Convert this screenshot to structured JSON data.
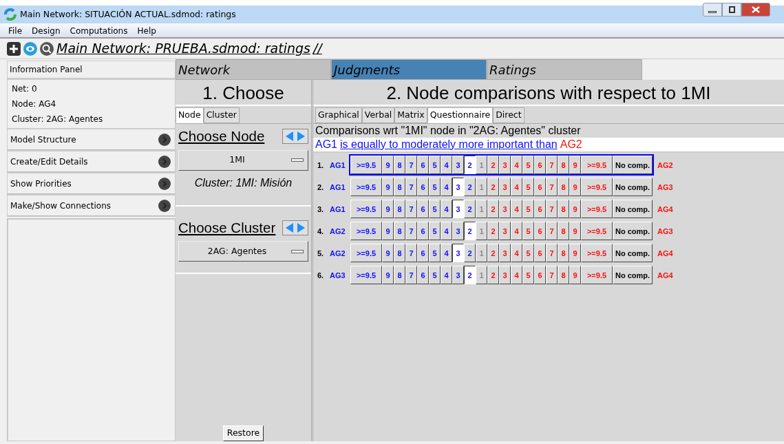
{
  "window": {
    "title": "Main Network: SITUACIÓN ACTUAL.sdmod: ratings"
  },
  "menu": [
    "File",
    "Design",
    "Computations",
    "Help"
  ],
  "toolbar": {
    "title": "Main Network: PRUEBA.sdmod: ratings",
    "suffix": "//"
  },
  "sidebar": {
    "info_title": "Information Panel",
    "info_lines": [
      "Net: 0",
      "Node: AG4",
      "Cluster: 2AG: Agentes"
    ],
    "items": [
      "Model Structure",
      "Create/Edit Details",
      "Show Priorities",
      "Make/Show Connections"
    ]
  },
  "main_tabs": [
    {
      "label": "Network",
      "selected": false
    },
    {
      "label": "Judgments",
      "selected": true
    },
    {
      "label": "Ratings",
      "selected": false
    }
  ],
  "choose": {
    "heading": "1. Choose",
    "tabs": [
      {
        "label": "Node",
        "selected": true
      },
      {
        "label": "Cluster",
        "selected": false
      }
    ],
    "node_label": "Choose Node",
    "node_value": "1MI",
    "node_cluster": "Cluster: 1MI: Misión",
    "cluster_label": "Choose Cluster",
    "cluster_value": "2AG: Agentes",
    "restore": "Restore"
  },
  "comparisons": {
    "heading": "2. Node comparisons with respect to 1MI",
    "tabs": [
      {
        "label": "Graphical",
        "selected": false
      },
      {
        "label": "Verbal",
        "selected": false
      },
      {
        "label": "Matrix",
        "selected": false
      },
      {
        "label": "Questionnaire",
        "selected": true
      },
      {
        "label": "Direct",
        "selected": false
      }
    ],
    "caption": "Comparisons wrt \"1MI\" node in \"2AG: Agentes\" cluster",
    "verdict": {
      "left": "AG1",
      "phrase": "is equally to moderately more important than",
      "right": "AG2"
    },
    "rows": [
      {
        "number": "1.",
        "left": "AG1",
        "right": "AG2",
        "focused": true,
        "cells": [
          {
            "label": ">=9.5",
            "kind": "left",
            "selected": false
          },
          {
            "label": "9",
            "kind": "left",
            "selected": false
          },
          {
            "label": "8",
            "kind": "left",
            "selected": false
          },
          {
            "label": "7",
            "kind": "left",
            "selected": false
          },
          {
            "label": "6",
            "kind": "left",
            "selected": false
          },
          {
            "label": "5",
            "kind": "left",
            "selected": false
          },
          {
            "label": "4",
            "kind": "left",
            "selected": false
          },
          {
            "label": "3",
            "kind": "left",
            "selected": false
          },
          {
            "label": "2",
            "kind": "left",
            "selected": true
          },
          {
            "label": "1",
            "kind": "center",
            "selected": false
          },
          {
            "label": "2",
            "kind": "right",
            "selected": false
          },
          {
            "label": "3",
            "kind": "right",
            "selected": false
          },
          {
            "label": "4",
            "kind": "right",
            "selected": false
          },
          {
            "label": "5",
            "kind": "right",
            "selected": false
          },
          {
            "label": "6",
            "kind": "right",
            "selected": false
          },
          {
            "label": "7",
            "kind": "right",
            "selected": false
          },
          {
            "label": "8",
            "kind": "right",
            "selected": false
          },
          {
            "label": "9",
            "kind": "right",
            "selected": false
          },
          {
            "label": ">=9.5",
            "kind": "right",
            "selected": false
          },
          {
            "label": "No comp.",
            "kind": "none",
            "selected": false
          }
        ]
      },
      {
        "number": "2.",
        "left": "AG1",
        "right": "AG3",
        "focused": false,
        "cells": [
          {
            "label": ">=9.5",
            "kind": "left",
            "selected": false
          },
          {
            "label": "9",
            "kind": "left",
            "selected": false
          },
          {
            "label": "8",
            "kind": "left",
            "selected": false
          },
          {
            "label": "7",
            "kind": "left",
            "selected": false
          },
          {
            "label": "6",
            "kind": "left",
            "selected": false
          },
          {
            "label": "5",
            "kind": "left",
            "selected": false
          },
          {
            "label": "4",
            "kind": "left",
            "selected": false
          },
          {
            "label": "3",
            "kind": "left",
            "selected": true
          },
          {
            "label": "2",
            "kind": "left",
            "selected": false
          },
          {
            "label": "1",
            "kind": "center",
            "selected": false
          },
          {
            "label": "2",
            "kind": "right",
            "selected": false
          },
          {
            "label": "3",
            "kind": "right",
            "selected": false
          },
          {
            "label": "4",
            "kind": "right",
            "selected": false
          },
          {
            "label": "5",
            "kind": "right",
            "selected": false
          },
          {
            "label": "6",
            "kind": "right",
            "selected": false
          },
          {
            "label": "7",
            "kind": "right",
            "selected": false
          },
          {
            "label": "8",
            "kind": "right",
            "selected": false
          },
          {
            "label": "9",
            "kind": "right",
            "selected": false
          },
          {
            "label": ">=9.5",
            "kind": "right",
            "selected": false
          },
          {
            "label": "No comp.",
            "kind": "none",
            "selected": false
          }
        ]
      },
      {
        "number": "3.",
        "left": "AG1",
        "right": "AG4",
        "focused": false,
        "cells": [
          {
            "label": ">=9.5",
            "kind": "left",
            "selected": false
          },
          {
            "label": "9",
            "kind": "left",
            "selected": false
          },
          {
            "label": "8",
            "kind": "left",
            "selected": false
          },
          {
            "label": "7",
            "kind": "left",
            "selected": false
          },
          {
            "label": "6",
            "kind": "left",
            "selected": false
          },
          {
            "label": "5",
            "kind": "left",
            "selected": false
          },
          {
            "label": "4",
            "kind": "left",
            "selected": false
          },
          {
            "label": "3",
            "kind": "left",
            "selected": true
          },
          {
            "label": "2",
            "kind": "left",
            "selected": false
          },
          {
            "label": "1",
            "kind": "center",
            "selected": false
          },
          {
            "label": "2",
            "kind": "right",
            "selected": false
          },
          {
            "label": "3",
            "kind": "right",
            "selected": false
          },
          {
            "label": "4",
            "kind": "right",
            "selected": false
          },
          {
            "label": "5",
            "kind": "right",
            "selected": false
          },
          {
            "label": "6",
            "kind": "right",
            "selected": false
          },
          {
            "label": "7",
            "kind": "right",
            "selected": false
          },
          {
            "label": "8",
            "kind": "right",
            "selected": false
          },
          {
            "label": "9",
            "kind": "right",
            "selected": false
          },
          {
            "label": ">=9.5",
            "kind": "right",
            "selected": false
          },
          {
            "label": "No comp.",
            "kind": "none",
            "selected": false
          }
        ]
      },
      {
        "number": "4.",
        "left": "AG2",
        "right": "AG3",
        "focused": false,
        "cells": [
          {
            "label": ">=9.5",
            "kind": "left",
            "selected": false
          },
          {
            "label": "9",
            "kind": "left",
            "selected": false
          },
          {
            "label": "8",
            "kind": "left",
            "selected": false
          },
          {
            "label": "7",
            "kind": "left",
            "selected": false
          },
          {
            "label": "6",
            "kind": "left",
            "selected": false
          },
          {
            "label": "5",
            "kind": "left",
            "selected": false
          },
          {
            "label": "4",
            "kind": "left",
            "selected": false
          },
          {
            "label": "3",
            "kind": "left",
            "selected": false
          },
          {
            "label": "2",
            "kind": "left",
            "selected": true
          },
          {
            "label": "1",
            "kind": "center",
            "selected": false
          },
          {
            "label": "2",
            "kind": "right",
            "selected": false
          },
          {
            "label": "3",
            "kind": "right",
            "selected": false
          },
          {
            "label": "4",
            "kind": "right",
            "selected": false
          },
          {
            "label": "5",
            "kind": "right",
            "selected": false
          },
          {
            "label": "6",
            "kind": "right",
            "selected": false
          },
          {
            "label": "7",
            "kind": "right",
            "selected": false
          },
          {
            "label": "8",
            "kind": "right",
            "selected": false
          },
          {
            "label": "9",
            "kind": "right",
            "selected": false
          },
          {
            "label": ">=9.5",
            "kind": "right",
            "selected": false
          },
          {
            "label": "No comp.",
            "kind": "none",
            "selected": false
          }
        ]
      },
      {
        "number": "5.",
        "left": "AG2",
        "right": "AG4",
        "focused": false,
        "cells": [
          {
            "label": ">=9.5",
            "kind": "left",
            "selected": false
          },
          {
            "label": "9",
            "kind": "left",
            "selected": false
          },
          {
            "label": "8",
            "kind": "left",
            "selected": false
          },
          {
            "label": "7",
            "kind": "left",
            "selected": false
          },
          {
            "label": "6",
            "kind": "left",
            "selected": false
          },
          {
            "label": "5",
            "kind": "left",
            "selected": false
          },
          {
            "label": "4",
            "kind": "left",
            "selected": false
          },
          {
            "label": "3",
            "kind": "left",
            "selected": true
          },
          {
            "label": "2",
            "kind": "left",
            "selected": false
          },
          {
            "label": "1",
            "kind": "center",
            "selected": false
          },
          {
            "label": "2",
            "kind": "right",
            "selected": false
          },
          {
            "label": "3",
            "kind": "right",
            "selected": false
          },
          {
            "label": "4",
            "kind": "right",
            "selected": false
          },
          {
            "label": "5",
            "kind": "right",
            "selected": false
          },
          {
            "label": "6",
            "kind": "right",
            "selected": false
          },
          {
            "label": "7",
            "kind": "right",
            "selected": false
          },
          {
            "label": "8",
            "kind": "right",
            "selected": false
          },
          {
            "label": "9",
            "kind": "right",
            "selected": false
          },
          {
            "label": ">=9.5",
            "kind": "right",
            "selected": false
          },
          {
            "label": "No comp.",
            "kind": "none",
            "selected": false
          }
        ]
      },
      {
        "number": "6.",
        "left": "AG3",
        "right": "AG4",
        "focused": false,
        "cells": [
          {
            "label": ">=9.5",
            "kind": "left",
            "selected": false
          },
          {
            "label": "9",
            "kind": "left",
            "selected": false
          },
          {
            "label": "8",
            "kind": "left",
            "selected": false
          },
          {
            "label": "7",
            "kind": "left",
            "selected": false
          },
          {
            "label": "6",
            "kind": "left",
            "selected": false
          },
          {
            "label": "5",
            "kind": "left",
            "selected": false
          },
          {
            "label": "4",
            "kind": "left",
            "selected": false
          },
          {
            "label": "3",
            "kind": "left",
            "selected": false
          },
          {
            "label": "2",
            "kind": "left",
            "selected": true
          },
          {
            "label": "1",
            "kind": "center",
            "selected": false
          },
          {
            "label": "2",
            "kind": "right",
            "selected": false
          },
          {
            "label": "3",
            "kind": "right",
            "selected": false
          },
          {
            "label": "4",
            "kind": "right",
            "selected": false
          },
          {
            "label": "5",
            "kind": "right",
            "selected": false
          },
          {
            "label": "6",
            "kind": "right",
            "selected": false
          },
          {
            "label": "7",
            "kind": "right",
            "selected": false
          },
          {
            "label": "8",
            "kind": "right",
            "selected": false
          },
          {
            "label": "9",
            "kind": "right",
            "selected": false
          },
          {
            "label": ">=9.5",
            "kind": "right",
            "selected": false
          },
          {
            "label": "No comp.",
            "kind": "none",
            "selected": false
          }
        ]
      }
    ]
  }
}
